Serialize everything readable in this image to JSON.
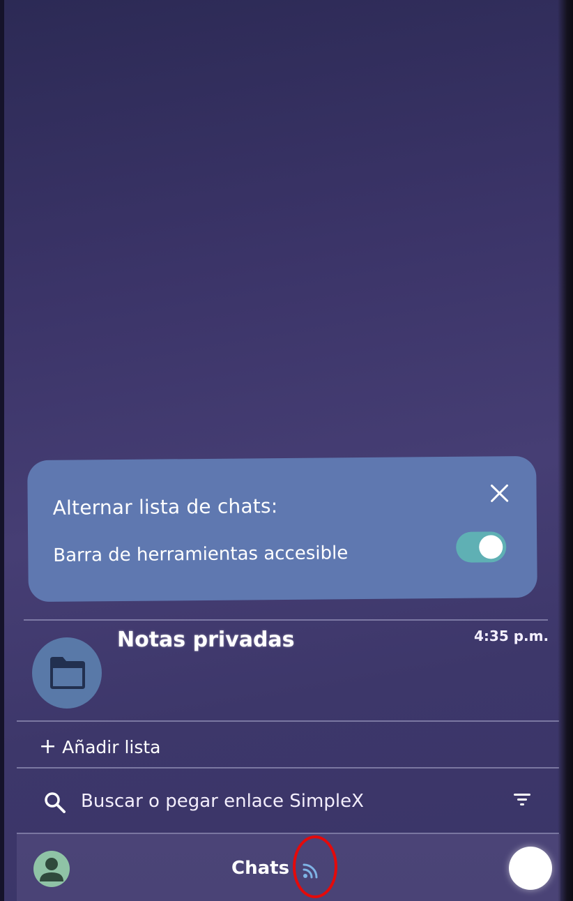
{
  "tooltip": {
    "title": "Alternar lista de chats:",
    "option_label": "Barra de herramientas accesible",
    "toggle_on": true,
    "close_icon": "close-icon"
  },
  "chat_list": [
    {
      "name": "Notas privadas",
      "time": "4:35 p.m.",
      "avatar_icon": "folder-icon"
    }
  ],
  "add_list": {
    "plus": "+",
    "label": "Añadir lista"
  },
  "search": {
    "placeholder": "Buscar o pegar enlace SimpleX",
    "icon": "search-icon",
    "filter_icon": "filter-icon"
  },
  "bottom_bar": {
    "title": "Chats",
    "status_icon": "feed-icon",
    "profile_icon": "person-icon"
  },
  "colors": {
    "background": "#3d376a",
    "tooltip_bg": "#5f78b0",
    "toggle_on": "#5fb0b4",
    "avatar": "#5979a8",
    "feed_icon": "#7fb4e6",
    "highlight": "#e40a0a"
  }
}
